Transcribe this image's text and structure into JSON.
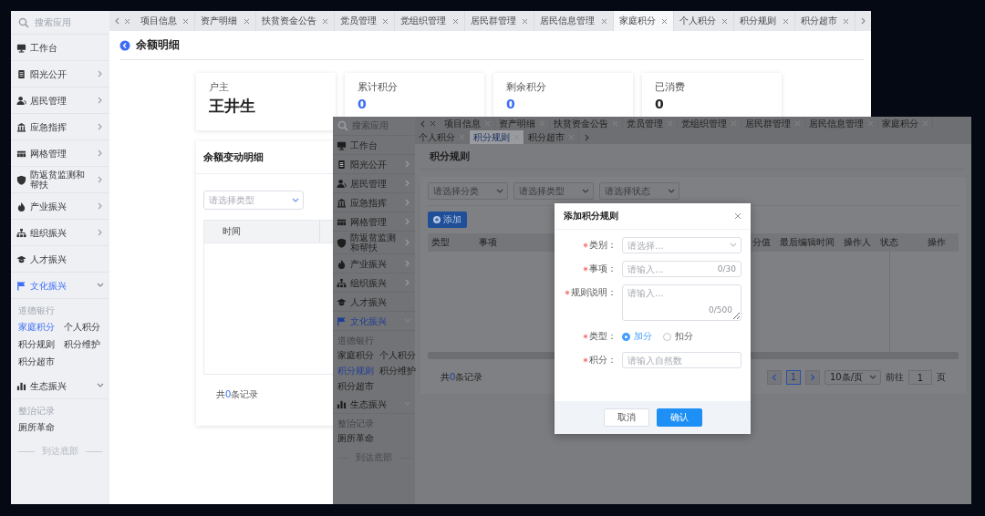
{
  "main_window": {
    "sidebar": {
      "search_placeholder": "搜索应用",
      "items": [
        {
          "label": "工作台",
          "kind": "link",
          "selected": false
        },
        {
          "label": "阳光公开",
          "kind": "menu",
          "expanded": false,
          "selected": false
        },
        {
          "label": "居民管理",
          "kind": "menu",
          "expanded": false,
          "selected": false
        },
        {
          "label": "应急指挥",
          "kind": "menu",
          "expanded": false,
          "selected": false
        },
        {
          "label": "网格管理",
          "kind": "menu",
          "expanded": false,
          "selected": false
        },
        {
          "label": "防返贫监测和帮扶",
          "kind": "menu",
          "expanded": false,
          "selected": false
        },
        {
          "label": "产业振兴",
          "kind": "menu",
          "expanded": false,
          "selected": false
        },
        {
          "label": "组织振兴",
          "kind": "menu",
          "expanded": false,
          "selected": false
        },
        {
          "label": "人才振兴",
          "kind": "link",
          "selected": false
        },
        {
          "label": "文化振兴",
          "kind": "menu",
          "expanded": true,
          "selected": true,
          "groups": [
            {
              "title": "道德银行",
              "links": [
                {
                  "label": "家庭积分",
                  "selected": true
                },
                {
                  "label": "个人积分",
                  "selected": false
                },
                {
                  "label": "积分规则",
                  "selected": false
                },
                {
                  "label": "积分维护",
                  "selected": false
                },
                {
                  "label": "积分超市",
                  "selected": false
                }
              ]
            }
          ]
        },
        {
          "label": "生态振兴",
          "kind": "menu",
          "expanded": true,
          "selected": false,
          "groups": [
            {
              "title": "整治记录",
              "links": [
                {
                  "label": "厕所革命",
                  "selected": false
                }
              ]
            }
          ]
        }
      ],
      "footer": "到达底部"
    },
    "tabs": [
      {
        "label": "项目信息",
        "selected": false
      },
      {
        "label": "资产明细",
        "selected": false
      },
      {
        "label": "扶贫资金公告",
        "selected": false
      },
      {
        "label": "党员管理",
        "selected": false
      },
      {
        "label": "党组织管理",
        "selected": false
      },
      {
        "label": "居民群管理",
        "selected": false
      },
      {
        "label": "居民信息管理",
        "selected": false
      },
      {
        "label": "家庭积分",
        "selected": true
      },
      {
        "label": "个人积分",
        "selected": false
      },
      {
        "label": "积分规则",
        "selected": false
      },
      {
        "label": "积分超市",
        "selected": false
      }
    ],
    "page_title": "余额明细",
    "stats": [
      {
        "label": "户主",
        "value": "王井生",
        "kind": "name",
        "color": "#222222"
      },
      {
        "label": "累计积分",
        "value": "0",
        "kind": "number",
        "color": "#3b6cf6"
      },
      {
        "label": "剩余积分",
        "value": "0",
        "kind": "number",
        "color": "#3b6cf6"
      },
      {
        "label": "已消费",
        "value": "0",
        "kind": "number",
        "color": "#222222"
      }
    ],
    "detail": {
      "title": "余额变动明细",
      "filter_placeholder": "请选择类型",
      "columns": [
        "时间"
      ],
      "record_count": {
        "prefix": "共",
        "count": "0",
        "suffix": "条记录"
      }
    }
  },
  "rules_window": {
    "sidebar": {
      "search_placeholder": "搜索应用",
      "items": [
        {
          "label": "工作台",
          "kind": "link",
          "selected": false
        },
        {
          "label": "阳光公开",
          "kind": "menu",
          "expanded": false,
          "selected": false
        },
        {
          "label": "居民管理",
          "kind": "menu",
          "expanded": false,
          "selected": false
        },
        {
          "label": "应急指挥",
          "kind": "menu",
          "expanded": false,
          "selected": false
        },
        {
          "label": "网格管理",
          "kind": "menu",
          "expanded": false,
          "selected": false
        },
        {
          "label": "防返贫监测和帮扶",
          "kind": "menu",
          "expanded": false,
          "selected": false
        },
        {
          "label": "产业振兴",
          "kind": "menu",
          "expanded": false,
          "selected": false
        },
        {
          "label": "组织振兴",
          "kind": "menu",
          "expanded": false,
          "selected": false
        },
        {
          "label": "人才振兴",
          "kind": "link",
          "selected": false
        },
        {
          "label": "文化振兴",
          "kind": "menu",
          "expanded": true,
          "selected": true,
          "groups": [
            {
              "title": "道德银行",
              "links": [
                {
                  "label": "家庭积分",
                  "selected": false
                },
                {
                  "label": "个人积分",
                  "selected": false
                },
                {
                  "label": "积分规则",
                  "selected": true
                },
                {
                  "label": "积分维护",
                  "selected": false
                },
                {
                  "label": "积分超市",
                  "selected": false
                }
              ]
            }
          ]
        },
        {
          "label": "生态振兴",
          "kind": "menu",
          "expanded": true,
          "selected": false,
          "groups": [
            {
              "title": "整治记录",
              "links": [
                {
                  "label": "厕所革命",
                  "selected": false
                }
              ]
            }
          ]
        }
      ],
      "footer": "到达底部"
    },
    "tabs": [
      {
        "label": "项目信息",
        "selected": false
      },
      {
        "label": "资产明细",
        "selected": false
      },
      {
        "label": "扶贫资金公告",
        "selected": false
      },
      {
        "label": "党员管理",
        "selected": false
      },
      {
        "label": "党组织管理",
        "selected": false
      },
      {
        "label": "居民群管理",
        "selected": false
      },
      {
        "label": "居民信息管理",
        "selected": false
      },
      {
        "label": "家庭积分",
        "selected": false
      },
      {
        "label": "个人积分",
        "selected": false
      },
      {
        "label": "积分规则",
        "selected": true
      },
      {
        "label": "积分超市",
        "selected": false
      }
    ],
    "page_title": "积分规则",
    "filters": [
      {
        "placeholder": "请选择分类"
      },
      {
        "placeholder": "请选择类型"
      },
      {
        "placeholder": "请选择状态"
      }
    ],
    "add_button": "添加",
    "columns": [
      "类型",
      "事项",
      "分值",
      "最后编辑时间",
      "操作人",
      "状态",
      "操作"
    ],
    "record_count": {
      "prefix": "共",
      "count": "0",
      "suffix": "条记录"
    },
    "pagination": {
      "pages": [
        {
          "label": "1",
          "selected": true
        }
      ],
      "page_size": "10条/页",
      "goto_label": "前往",
      "goto_value": "1",
      "page_suffix": "页"
    },
    "dialog": {
      "title": "添加积分规则",
      "fields": [
        {
          "kind": "select",
          "label": "类别：",
          "required": true,
          "placeholder": "请选择..."
        },
        {
          "kind": "input",
          "label": "事项：",
          "required": true,
          "placeholder": "请输入...",
          "counter": "0/30"
        },
        {
          "kind": "textarea",
          "label": "规则说明：",
          "required": true,
          "placeholder": "请输入...",
          "counter": "0/500"
        },
        {
          "kind": "radio",
          "label": "类型：",
          "required": true,
          "options": [
            {
              "label": "加分",
              "selected": true
            },
            {
              "label": "扣分",
              "selected": false
            }
          ]
        },
        {
          "kind": "input",
          "label": "积分：",
          "required": true,
          "placeholder": "请输入自然数"
        }
      ],
      "buttons": [
        {
          "label": "取消",
          "kind": "secondary"
        },
        {
          "label": "确认",
          "kind": "primary"
        }
      ]
    }
  }
}
